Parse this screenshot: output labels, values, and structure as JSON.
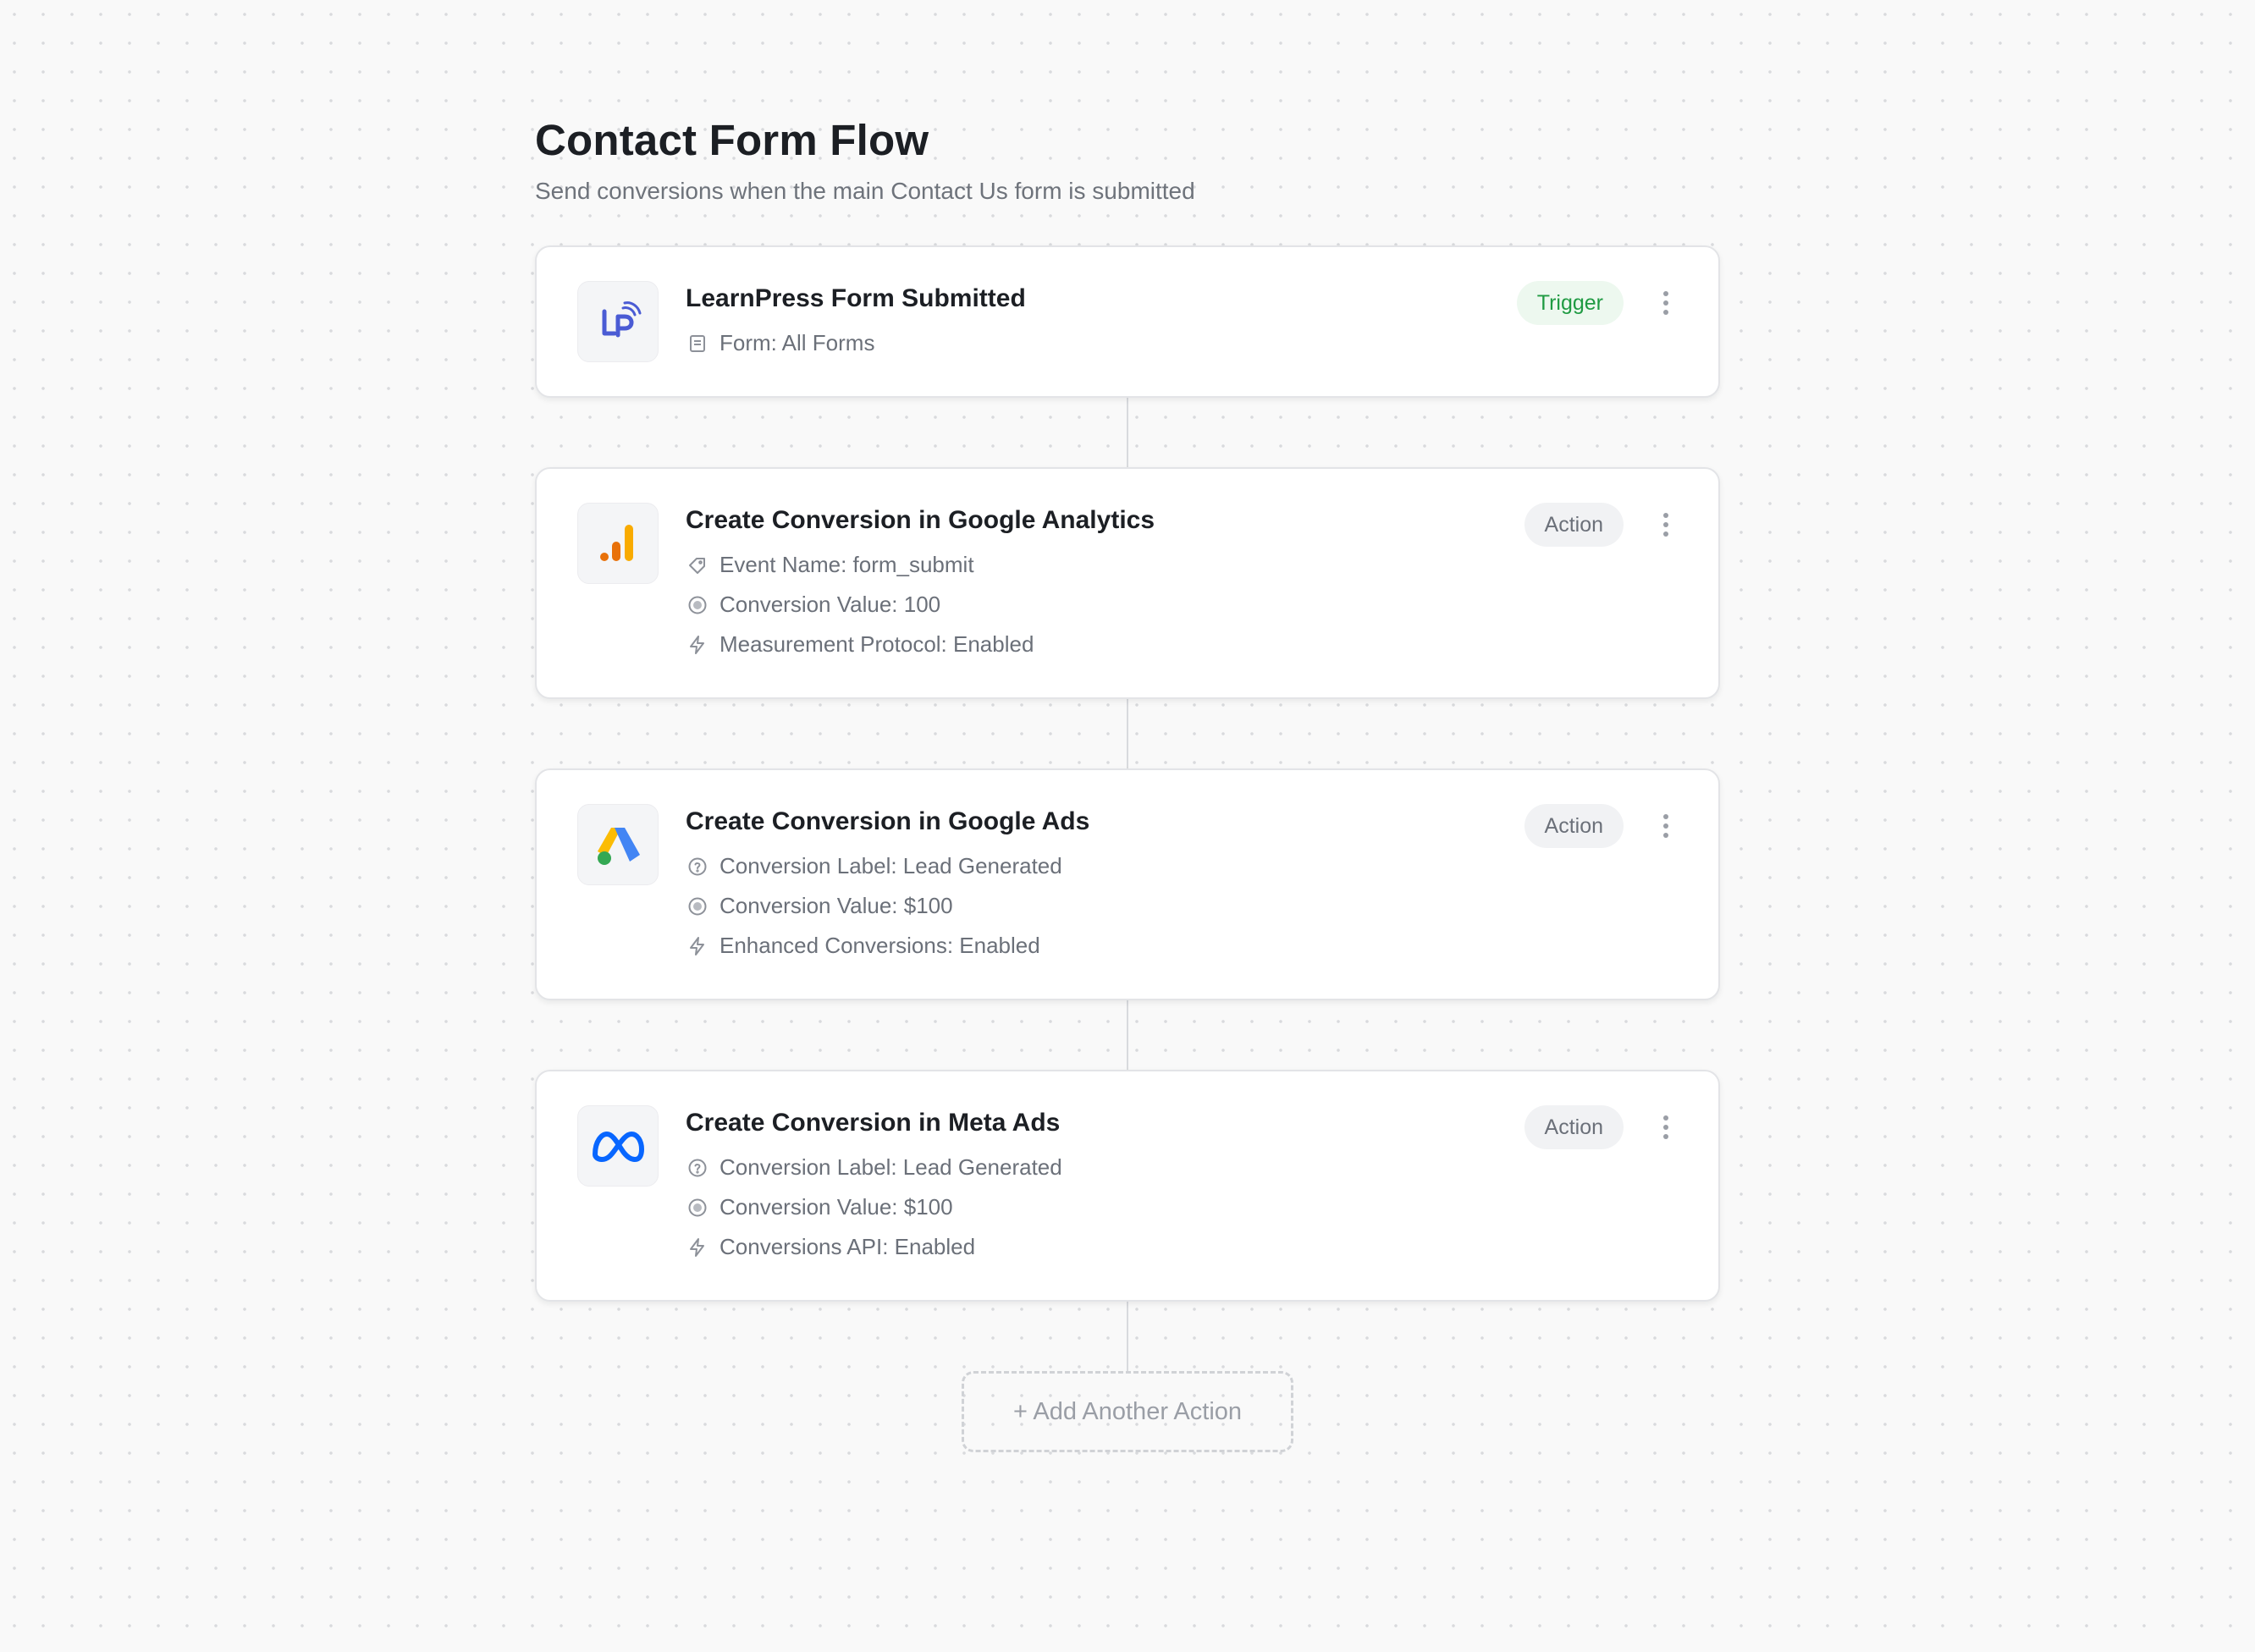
{
  "header": {
    "title": "Contact Form Flow",
    "subtitle": "Send conversions when the main Contact Us form is submitted"
  },
  "steps": [
    {
      "logo": "learnpress-logo",
      "title": "LearnPress Form Submitted",
      "badge": "Trigger",
      "details": [
        {
          "icon": "form-icon",
          "text": "Form: All Forms"
        }
      ]
    },
    {
      "logo": "google-analytics-logo",
      "title": "Create Conversion in Google Analytics",
      "badge": "Action",
      "details": [
        {
          "icon": "tag-icon",
          "text": "Event Name: form_submit"
        },
        {
          "icon": "currency-icon",
          "text": "Conversion Value: 100"
        },
        {
          "icon": "lightning-icon",
          "text": "Measurement Protocol: Enabled"
        }
      ]
    },
    {
      "logo": "google-ads-logo",
      "title": "Create Conversion in Google Ads",
      "badge": "Action",
      "details": [
        {
          "icon": "help-circle-icon",
          "text": "Conversion Label: Lead Generated"
        },
        {
          "icon": "currency-icon",
          "text": "Conversion Value: $100"
        },
        {
          "icon": "lightning-icon",
          "text": "Enhanced Conversions: Enabled"
        }
      ]
    },
    {
      "logo": "meta-logo",
      "title": "Create Conversion in Meta Ads",
      "badge": "Action",
      "details": [
        {
          "icon": "help-circle-icon",
          "text": "Conversion Label: Lead Generated"
        },
        {
          "icon": "currency-icon",
          "text": "Conversion Value: $100"
        },
        {
          "icon": "lightning-icon",
          "text": "Conversions API: Enabled"
        }
      ]
    }
  ],
  "add_action_label": "+ Add Another Action",
  "colors": {
    "trigger_badge_text": "#1f9a42",
    "trigger_badge_bg": "#edf8ef",
    "action_badge_bg": "#f1f2f4",
    "learnpress_blue": "#4a5bd4",
    "ga_orange": "#e8710a",
    "ga_yellow": "#f9ab00",
    "meta_blue": "#0866ff"
  }
}
